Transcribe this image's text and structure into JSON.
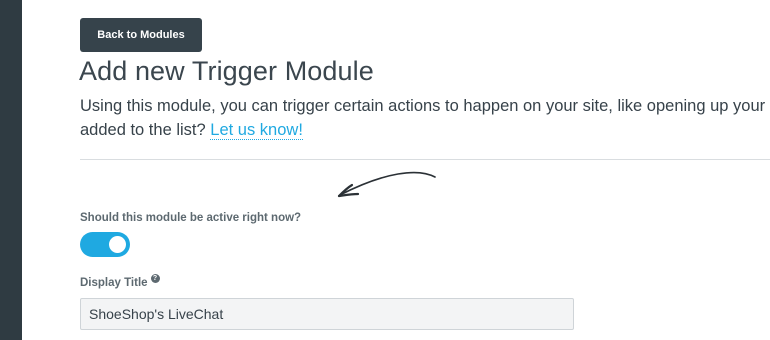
{
  "back_button": {
    "label": "Back to Modules"
  },
  "page": {
    "title": "Add new Trigger Module",
    "description_line1": "Using this module, you can trigger certain actions to happen on your site, like opening up your exis",
    "description_line2_prefix": "added to the list? ",
    "contact_link": "Let us know!"
  },
  "form": {
    "active_label": "Should this module be active right now?",
    "active_value": true,
    "display_title_label": "Display Title",
    "help_icon_glyph": "?",
    "display_title_value": "ShoeShop's LiveChat"
  },
  "colors": {
    "accent": "#1fa9e1",
    "button_bg": "#36434b",
    "sidebar": "#2f3b42"
  },
  "icons": {
    "help": "question-circle-icon",
    "arrow": "hand-drawn-arrow-icon"
  }
}
